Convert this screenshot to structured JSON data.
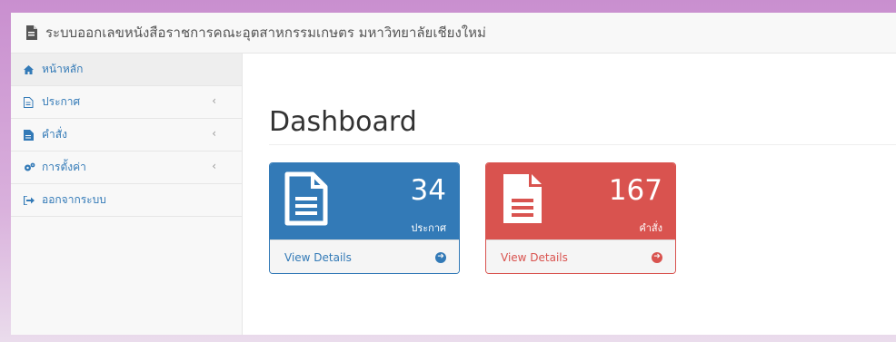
{
  "header": {
    "title": "ระบบออกเลขหนังสือราชการคณะอุตสาหกรรมเกษตร มหาวิทยาลัยเชียงใหม่",
    "icon": "file-icon"
  },
  "sidebar": {
    "items": [
      {
        "label": "หน้าหลัก",
        "icon": "home-icon",
        "has_chevron": false,
        "active": true
      },
      {
        "label": "ประกาศ",
        "icon": "file-text-icon",
        "has_chevron": true
      },
      {
        "label": "คำสั่ง",
        "icon": "file-icon",
        "has_chevron": true
      },
      {
        "label": "การตั้งค่า",
        "icon": "gears-icon",
        "has_chevron": true
      },
      {
        "label": "ออกจากระบบ",
        "icon": "sign-out-icon",
        "has_chevron": false
      }
    ],
    "chevron": "‹"
  },
  "main": {
    "title": "Dashboard",
    "panels": [
      {
        "count": "34",
        "label": "ประกาศ",
        "link": "View Details",
        "color": "#337ab7",
        "icon": "file-text-icon"
      },
      {
        "count": "167",
        "label": "คำสั่ง",
        "link": "View Details",
        "color": "#d9534f",
        "icon": "file-icon"
      }
    ]
  }
}
